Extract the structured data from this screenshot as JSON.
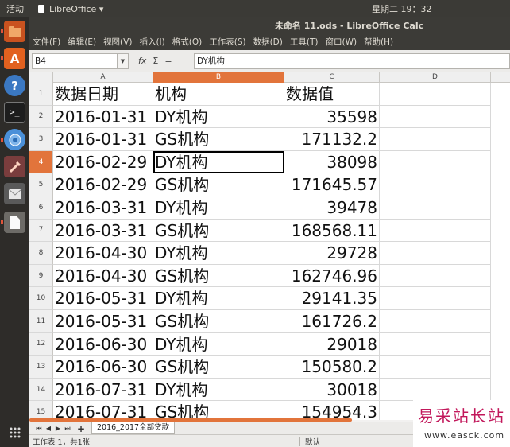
{
  "top_panel": {
    "activities": "活动",
    "app_name": "LibreOffice ▾",
    "clock": "星期二 19：32"
  },
  "window": {
    "title": "未命名 11.ods - LibreOffice Calc"
  },
  "menu": [
    "文件(F)",
    "编辑(E)",
    "视图(V)",
    "插入(I)",
    "格式(O)",
    "工作表(S)",
    "数据(D)",
    "工具(T)",
    "窗口(W)",
    "帮助(H)"
  ],
  "formula_bar": {
    "name_box": "B4",
    "fx": "fx",
    "sum": "Σ",
    "equals": "=",
    "content": "DY机构"
  },
  "columns": [
    "A",
    "B",
    "C",
    "D"
  ],
  "selected_column": "B",
  "selected_row": 4,
  "rows": [
    {
      "n": "1",
      "a": "数据日期",
      "b": "机构",
      "c": "数据值",
      "header": true
    },
    {
      "n": "2",
      "a": "2016-01-31",
      "b": "DY机构",
      "c": "35598"
    },
    {
      "n": "3",
      "a": "2016-01-31",
      "b": "GS机构",
      "c": "171132.2"
    },
    {
      "n": "4",
      "a": "2016-02-29",
      "b": "DY机构",
      "c": "38098"
    },
    {
      "n": "5",
      "a": "2016-02-29",
      "b": "GS机构",
      "c": "171645.57"
    },
    {
      "n": "6",
      "a": "2016-03-31",
      "b": "DY机构",
      "c": "39478"
    },
    {
      "n": "7",
      "a": "2016-03-31",
      "b": "GS机构",
      "c": "168568.11"
    },
    {
      "n": "8",
      "a": "2016-04-30",
      "b": "DY机构",
      "c": "29728"
    },
    {
      "n": "9",
      "a": "2016-04-30",
      "b": "GS机构",
      "c": "162746.96"
    },
    {
      "n": "10",
      "a": "2016-05-31",
      "b": "DY机构",
      "c": "29141.35"
    },
    {
      "n": "11",
      "a": "2016-05-31",
      "b": "GS机构",
      "c": "161726.2"
    },
    {
      "n": "12",
      "a": "2016-06-30",
      "b": "DY机构",
      "c": "29018"
    },
    {
      "n": "13",
      "a": "2016-06-30",
      "b": "GS机构",
      "c": "150580.2"
    },
    {
      "n": "14",
      "a": "2016-07-31",
      "b": "DY机构",
      "c": "30018"
    },
    {
      "n": "15",
      "a": "2016-07-31",
      "b": "GS机构",
      "c": "154954.3"
    }
  ],
  "sheet_tab": "2016_2017全部贷款",
  "status": {
    "sheet_info": "工作表 1，共1张",
    "page_style": "默认"
  },
  "watermark": {
    "text_cn": "易采站长站",
    "url": "www.easck.com"
  },
  "colors": {
    "accent": "#e2743b",
    "panel": "#3c3b37",
    "launcher": "#2e2c29"
  }
}
